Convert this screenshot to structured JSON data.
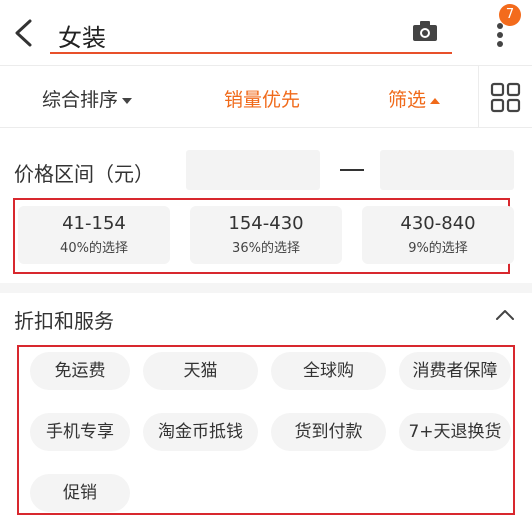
{
  "header": {
    "search_text": "女装",
    "badge_count": "7"
  },
  "sort_bar": {
    "general": "综合排序",
    "sales": "销量优先",
    "filter": "筛选"
  },
  "price": {
    "label": "价格区间（元）",
    "options": [
      {
        "range": "41-154",
        "share": "40%的选择"
      },
      {
        "range": "154-430",
        "share": "36%的选择"
      },
      {
        "range": "430-840",
        "share": "9%的选择"
      }
    ]
  },
  "services": {
    "title": "折扣和服务",
    "tags": [
      "免运费",
      "天猫",
      "全球购",
      "消费者保障",
      "手机专享",
      "淘金币抵钱",
      "货到付款",
      "7+天退换货",
      "促销"
    ]
  },
  "colors": {
    "accent": "#f06a1a",
    "highlight_frame": "#d8282e",
    "badge": "#f36b1c"
  }
}
